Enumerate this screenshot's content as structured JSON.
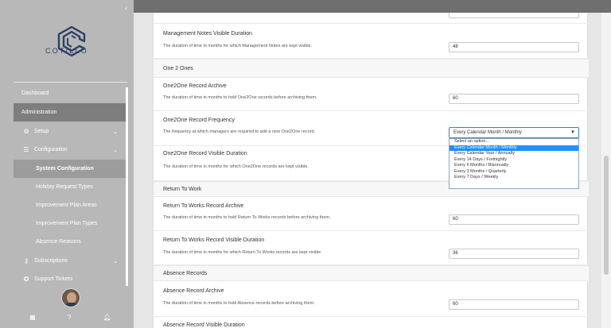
{
  "sidebar": {
    "brand": "COTILLO",
    "collapse_icon": "‹",
    "items": [
      {
        "label": "Dashboard"
      },
      {
        "label": "Administration"
      },
      {
        "label": "Setup",
        "icon": "gear-icon"
      },
      {
        "label": "Configuration",
        "icon": "sliders-icon"
      },
      {
        "label": "System Configuration"
      },
      {
        "label": "Holiday Request Types"
      },
      {
        "label": "Improvement Plan Areas"
      },
      {
        "label": "Improvement Plan Types"
      },
      {
        "label": "Absence Reasons"
      },
      {
        "label": "Subscriptions",
        "icon": "key-icon"
      },
      {
        "label": "Support Tickets",
        "icon": "lifebuoy-icon"
      }
    ],
    "footer_icons": [
      "grid-icon",
      "help-icon",
      "bell-icon"
    ]
  },
  "settings": {
    "top_field_value": "",
    "management_notes_visible": {
      "title": "Management Notes Visible Duration",
      "desc": "The duration of time in months for which Management Notes are kept visible.",
      "value": "48"
    },
    "one2ones_section": "One 2 Ones",
    "one2one_archive": {
      "title": "One2One Record Archive",
      "desc": "The duration of time in months to hold One2One records before archiving them.",
      "value": "60"
    },
    "one2one_frequency": {
      "title": "One2One Record Frequency",
      "desc": "The frequency at which managers are required to add a new One2One record.",
      "selected": "Every Calendar Month / Monthly",
      "options": [
        "Select an option...",
        "Every Calendar Month / Monthly",
        "Every Calendar Year / Annually",
        "Every 14 Days / Fortnightly",
        "Every 6 Months / Biannually",
        "Every 3 Months / Quarterly",
        "Every 7 Days / Weekly"
      ]
    },
    "one2one_visible": {
      "title": "One2One Record Visible Duration",
      "desc": "The duration of time in months for which One2One records are kept visible."
    },
    "return_section": "Return To Work",
    "rtw_archive": {
      "title": "Return To Works Record Archive",
      "desc": "The duration of time in months to hold Return To Works records before archiving them.",
      "value": "60"
    },
    "rtw_visible": {
      "title": "Return To Works Record Visible Duration",
      "desc": "The duration of time in months for which Return To Works records are kept visible.",
      "value": "36"
    },
    "absence_section": "Absence Records",
    "absence_archive": {
      "title": "Absence Record Archive",
      "desc": "The duration of time in months to hold Absence records before archiving them.",
      "value": "60"
    },
    "absence_visible": {
      "title": "Absence Record Visible Duration"
    }
  },
  "colors": {
    "sidebar_bg": "#b8b8b8",
    "active_nav": "#7e7e7e",
    "brand": "#2d3f66",
    "highlight": "#1e90ff"
  }
}
